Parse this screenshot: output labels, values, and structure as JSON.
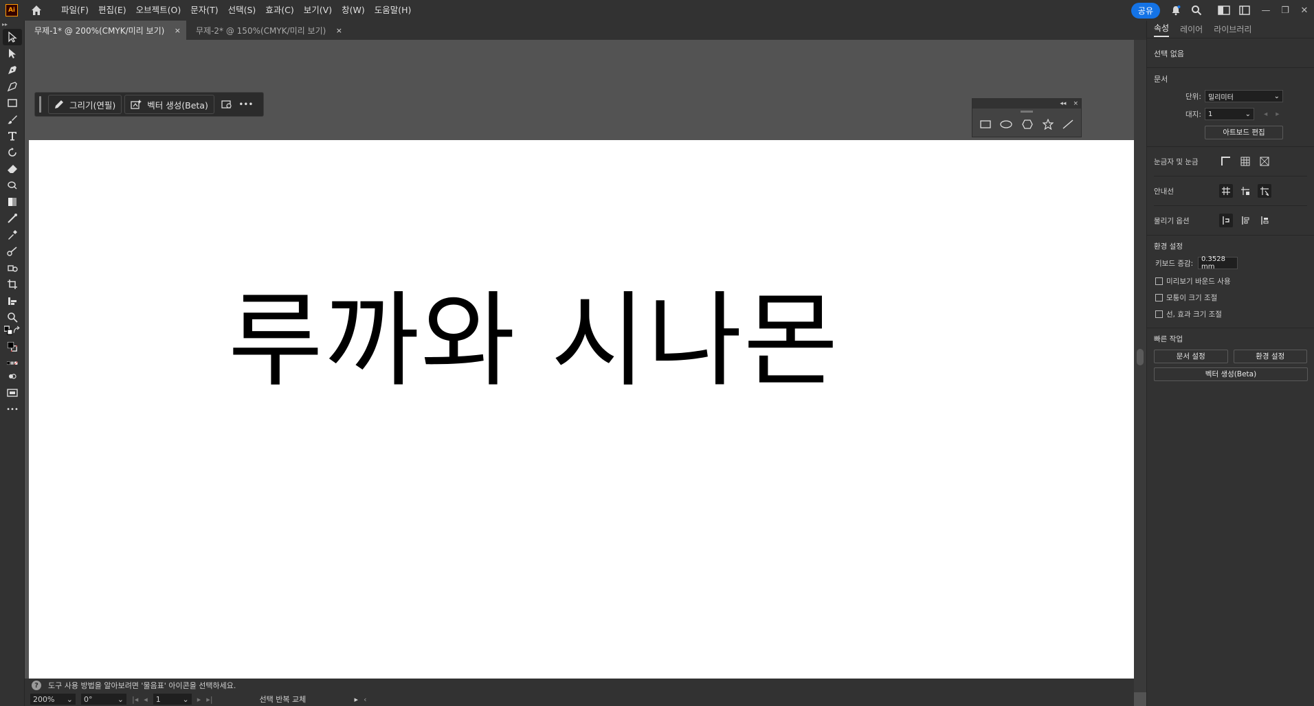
{
  "app": {
    "logo": "Ai"
  },
  "menu": {
    "items": [
      "파일(F)",
      "편집(E)",
      "오브젝트(O)",
      "문자(T)",
      "선택(S)",
      "효과(C)",
      "보기(V)",
      "창(W)",
      "도움말(H)"
    ],
    "share_label": "공유"
  },
  "tabs": [
    {
      "label": "무제-1* @ 200%(CMYK/미리 보기)",
      "close": "×"
    },
    {
      "label": "무제-2* @ 150%(CMYK/미리 보기)",
      "close": "×"
    }
  ],
  "context_bar": {
    "draw_label": "그리기(연필)",
    "vector_label": "벡터 생성(Beta)",
    "more": "•••"
  },
  "shape_panel": {
    "collapse": "◂◂",
    "close": "×"
  },
  "artboard": {
    "text": "루까와 시나몬"
  },
  "status": {
    "hint": "도구 사용 방법을 알아보려면 '물음표' 아이콘을 선택하세요.",
    "help": "?",
    "zoom": "200%",
    "rotation": "0°",
    "artboard_num": "1",
    "selection_mode": "선택 반복 교체"
  },
  "panel": {
    "tabs": [
      "속성",
      "레이어",
      "라이브러리"
    ],
    "no_selection": "선택 없음",
    "document_title": "문서",
    "unit_label": "단위:",
    "unit_value": "밀리미터",
    "artboard_label": "대지:",
    "artboard_value": "1",
    "edit_artboard_btn": "아트보드 편집",
    "rulers_label": "눈금자 및 눈금",
    "guides_label": "안내선",
    "snap_label": "물리기 옵션",
    "prefs_title": "환경 설정",
    "keyboard_inc_label": "키보드 증감:",
    "keyboard_inc_value": "0.3528 mm",
    "check_preview_bounds": "미리보기 바운드 사용",
    "check_scale_corners": "모퉁이 크기 조절",
    "check_scale_strokes": "선, 효과 크기 조절",
    "quick_title": "빠른 작업",
    "doc_setup_btn": "문서 설정",
    "prefs_btn": "환경 설정",
    "vector_btn": "벡터 생성(Beta)"
  }
}
